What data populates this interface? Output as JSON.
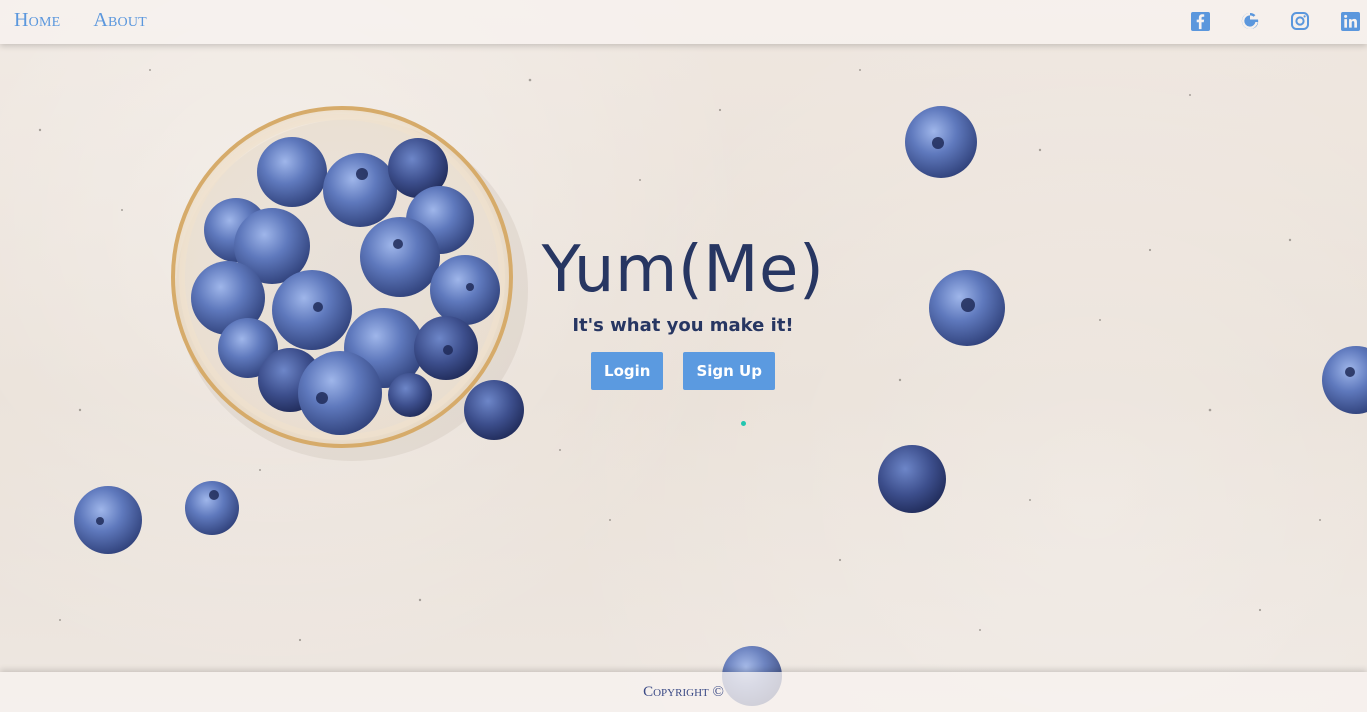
{
  "nav": {
    "items": [
      {
        "label": "Home"
      },
      {
        "label": "About"
      }
    ],
    "social": [
      {
        "icon": "facebook-icon"
      },
      {
        "icon": "google-icon"
      },
      {
        "icon": "instagram-icon"
      },
      {
        "icon": "linkedin-icon"
      }
    ],
    "accent_color": "#5b97dd"
  },
  "hero": {
    "title": "Yum(Me)",
    "subtitle": "It's what you make it!",
    "buttons": {
      "login_label": "Login",
      "signup_label": "Sign Up"
    },
    "title_color": "#273662",
    "button_color": "#5b9ae0"
  },
  "footer": {
    "copyright": "Copyright ©"
  }
}
